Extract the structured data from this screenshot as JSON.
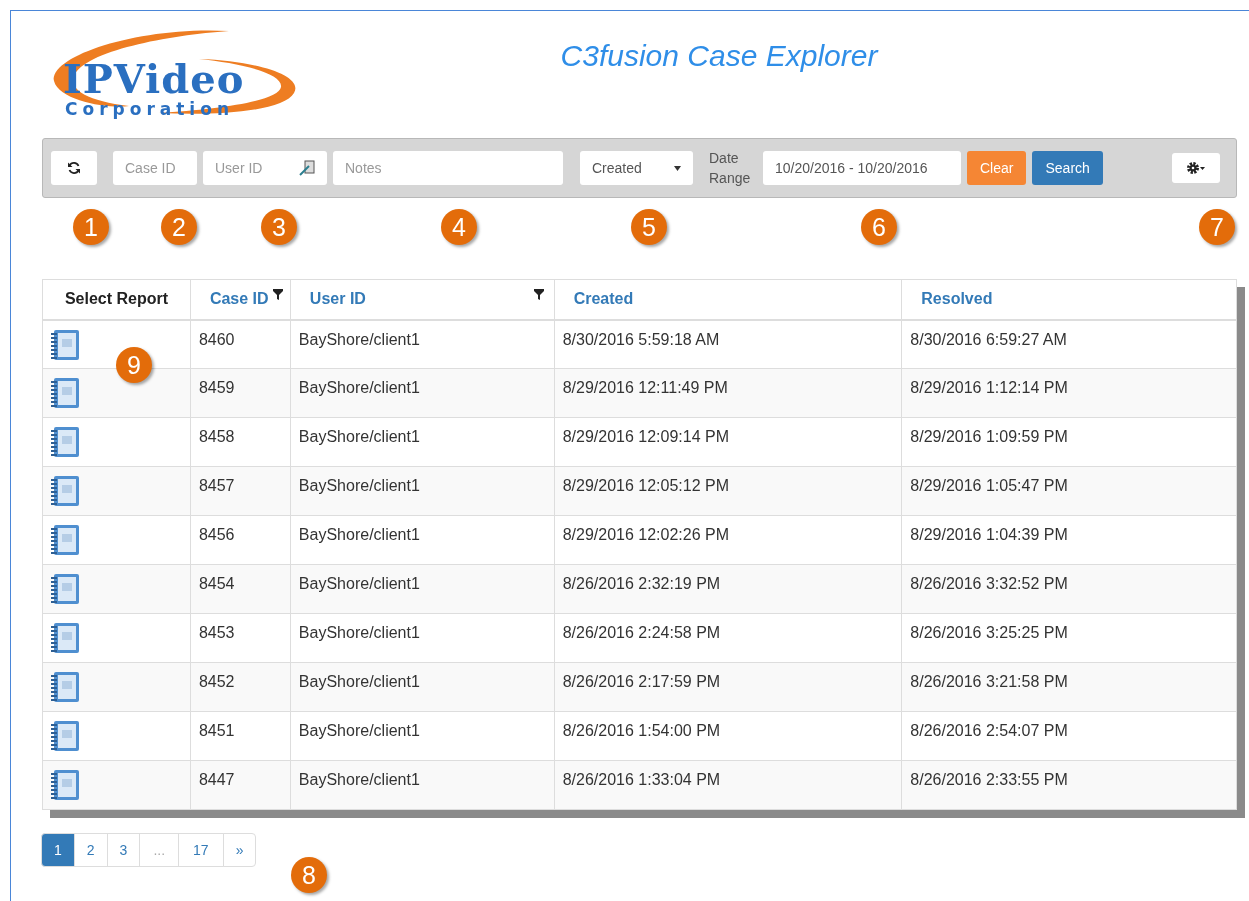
{
  "logo": {
    "name": "IPVideo",
    "subtitle": "Corporation"
  },
  "title": "C3fusion Case Explorer",
  "toolbar": {
    "case_id": {
      "placeholder": "Case ID"
    },
    "user_id": {
      "placeholder": "User ID"
    },
    "notes": {
      "placeholder": "Notes"
    },
    "date_field": {
      "value": "Created"
    },
    "date_range_label": "Date Range",
    "date_range": {
      "value": "10/20/2016 - 10/20/2016"
    },
    "clear_button": "Clear",
    "search_button": "Search"
  },
  "callouts": [
    "1",
    "2",
    "3",
    "4",
    "5",
    "6",
    "7",
    "8",
    "9"
  ],
  "table": {
    "columns": [
      {
        "label": "Select Report",
        "link": false,
        "filter": false
      },
      {
        "label": "Case ID",
        "link": true,
        "filter": true
      },
      {
        "label": "User ID",
        "link": true,
        "filter": true
      },
      {
        "label": "Created",
        "link": true,
        "filter": false
      },
      {
        "label": "Resolved",
        "link": true,
        "filter": false
      }
    ],
    "rows": [
      [
        "",
        "8460",
        "BayShore/client1",
        "8/30/2016 5:59:18 AM",
        "8/30/2016 6:59:27 AM"
      ],
      [
        "",
        "8459",
        "BayShore/client1",
        "8/29/2016 12:11:49 PM",
        "8/29/2016 1:12:14 PM"
      ],
      [
        "",
        "8458",
        "BayShore/client1",
        "8/29/2016 12:09:14 PM",
        "8/29/2016 1:09:59 PM"
      ],
      [
        "",
        "8457",
        "BayShore/client1",
        "8/29/2016 12:05:12 PM",
        "8/29/2016 1:05:47 PM"
      ],
      [
        "",
        "8456",
        "BayShore/client1",
        "8/29/2016 12:02:26 PM",
        "8/29/2016 1:04:39 PM"
      ],
      [
        "",
        "8454",
        "BayShore/client1",
        "8/26/2016 2:32:19 PM",
        "8/26/2016 3:32:52 PM"
      ],
      [
        "",
        "8453",
        "BayShore/client1",
        "8/26/2016 2:24:58 PM",
        "8/26/2016 3:25:25 PM"
      ],
      [
        "",
        "8452",
        "BayShore/client1",
        "8/26/2016 2:17:59 PM",
        "8/26/2016 3:21:58 PM"
      ],
      [
        "",
        "8451",
        "BayShore/client1",
        "8/26/2016 1:54:00 PM",
        "8/26/2016 2:54:07 PM"
      ],
      [
        "",
        "8447",
        "BayShore/client1",
        "8/26/2016 1:33:04 PM",
        "8/26/2016 2:33:55 PM"
      ]
    ]
  },
  "pagination": [
    {
      "label": "1",
      "selected": true,
      "disabled": false
    },
    {
      "label": "2",
      "selected": false,
      "disabled": false
    },
    {
      "label": "3",
      "selected": false,
      "disabled": false
    },
    {
      "label": "...",
      "selected": false,
      "disabled": true
    },
    {
      "label": "17",
      "selected": false,
      "disabled": false
    },
    {
      "label": "»",
      "selected": false,
      "disabled": false
    }
  ]
}
